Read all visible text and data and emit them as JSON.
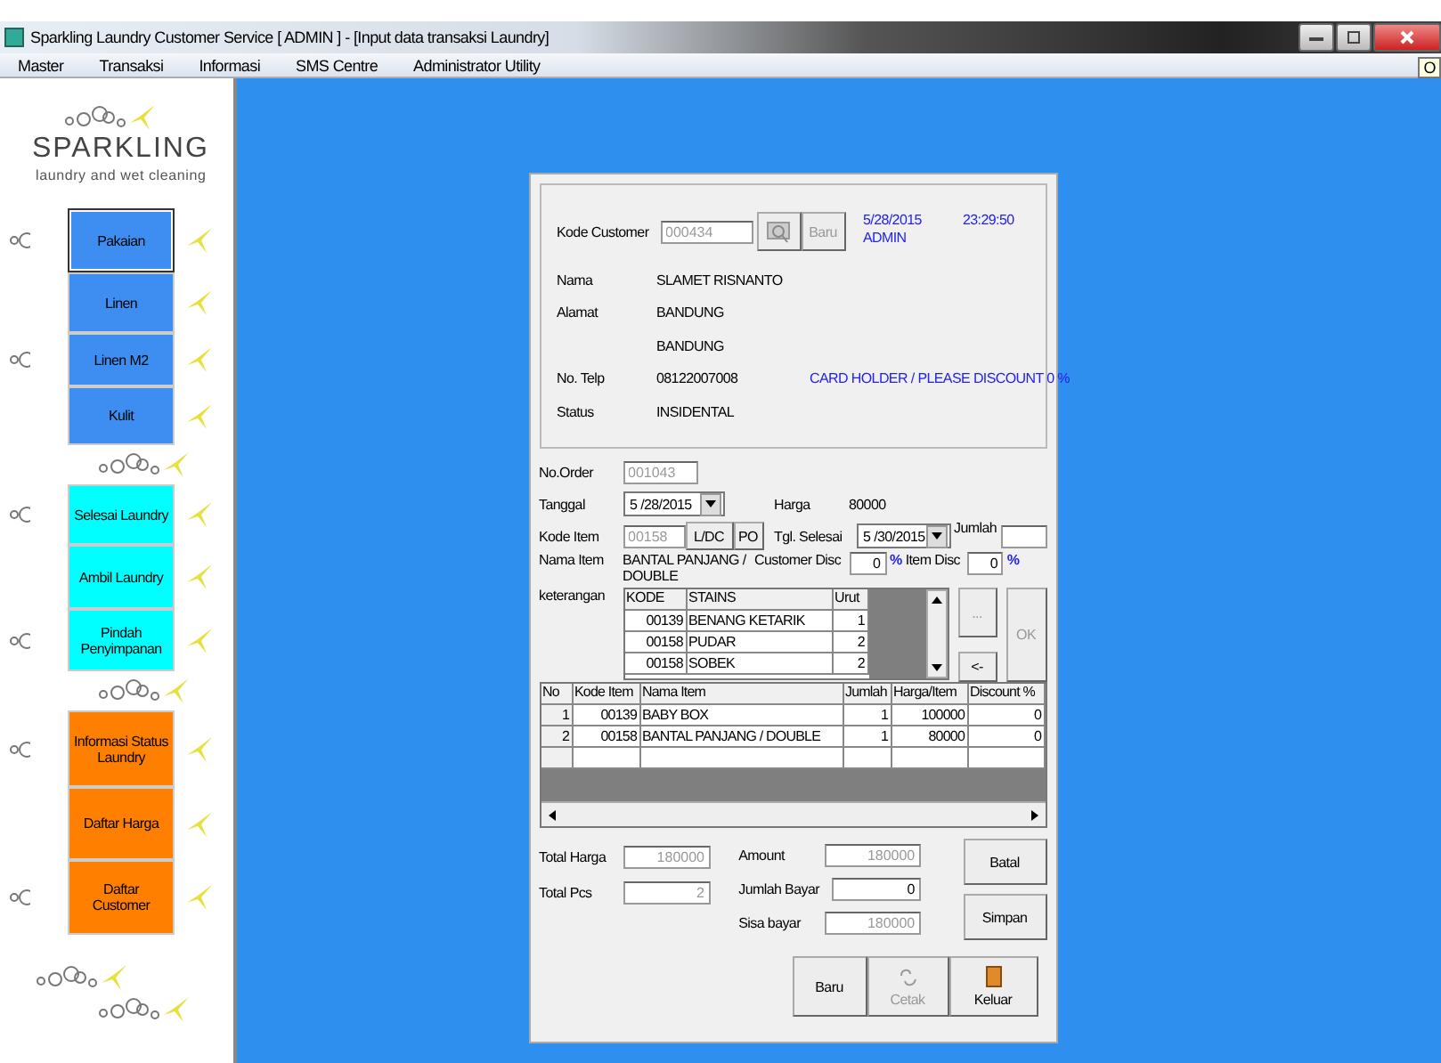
{
  "window": {
    "title": "Sparkling Laundry Customer Service [ ADMIN ] - [Input data transaksi Laundry]",
    "tooltip": "O"
  },
  "menu": [
    "Master",
    "Transaksi",
    "Informasi",
    "SMS Centre",
    "Administrator Utility"
  ],
  "brand": {
    "name": "SPARKLING",
    "tagline": "laundry and wet cleaning"
  },
  "sidebar": {
    "groups": [
      {
        "color": "#3d8ef0",
        "items": [
          {
            "label": "Pakaian",
            "selected": true
          },
          {
            "label": "Linen",
            "selected": false
          },
          {
            "label": "Linen M2",
            "selected": false
          },
          {
            "label": "Kulit",
            "selected": false
          }
        ]
      },
      {
        "color": "#00ffff",
        "items": [
          {
            "label": "Selesai Laundry",
            "selected": false
          },
          {
            "label": "Ambil Laundry",
            "selected": false
          },
          {
            "label": "Pindah Penyimpanan",
            "selected": false
          }
        ]
      },
      {
        "color": "#ff7f00",
        "items": [
          {
            "label": "Informasi Status Laundry",
            "selected": false
          },
          {
            "label": "Daftar Harga",
            "selected": false
          },
          {
            "label": "Daftar Customer",
            "selected": false
          }
        ]
      }
    ]
  },
  "customer": {
    "code_label": "Kode Customer",
    "code": "000434",
    "new_button": {
      "label": "Baru",
      "disabled": true
    },
    "date": "5/28/2015",
    "time": "23:29:50",
    "user": "ADMIN",
    "fields": [
      {
        "label": "Nama",
        "value": "SLAMET RISNANTO"
      },
      {
        "label": "Alamat",
        "value": "BANDUNG"
      },
      {
        "value": "BANDUNG"
      },
      {
        "label": "No. Telp",
        "value": "08122007008"
      },
      {
        "label": "Status",
        "value": "INSIDENTAL"
      }
    ],
    "notice": "CARD HOLDER / PLEASE DISCOUNT 0 %"
  },
  "order": {
    "no_label": "No.Order",
    "no": "001043",
    "date_label": "Tanggal",
    "date": "5 /28/2015",
    "price_label": "Harga",
    "price": "80000",
    "item_label": "Kode Item",
    "item_code": "00158",
    "ldc_button": "L/DC",
    "po_button": "PO",
    "finish_label": "Tgl. Selesai",
    "finish_date": "5 /30/2015",
    "qty_label": "Jumlah",
    "name_label": "Nama Item",
    "item_name": "BANTAL PANJANG / DOUBLE",
    "cust_disc_label": "Customer Disc",
    "cust_disc": "0",
    "item_disc_label": "Item Disc",
    "item_disc": "0",
    "percent": "%",
    "note_label": "keterangan",
    "stains": {
      "columns": [
        "KODE",
        "STAINS",
        "Urut"
      ],
      "rows": [
        [
          "00139",
          "BENANG KETARIK",
          "1"
        ],
        [
          "00158",
          "PUDAR",
          "2"
        ],
        [
          "00158",
          "SOBEK",
          "2"
        ]
      ]
    },
    "side_buttons": [
      {
        "label": "...",
        "disabled": true
      },
      {
        "label": "<-",
        "disabled": false
      },
      {
        "label": "OK",
        "disabled": true
      }
    ]
  },
  "items": {
    "columns": [
      "No",
      "Kode Item",
      "Nama Item",
      "Jumlah",
      "Harga/Item",
      "Discount %"
    ],
    "rows": [
      [
        "1",
        "00139",
        "BABY BOX",
        "1",
        "100000",
        "0"
      ],
      [
        "2",
        "00158",
        "BANTAL PANJANG / DOUBLE",
        "1",
        "80000",
        "0"
      ]
    ]
  },
  "totals": {
    "total_price_label": "Total Harga",
    "total_price": "180000",
    "total_pcs_label": "Total Pcs",
    "total_pcs": "2",
    "amount_label": "Amount",
    "amount": "180000",
    "paid_label": "Jumlah Bayar",
    "paid": "0",
    "rest_label": "Sisa bayar",
    "rest": "180000"
  },
  "buttons": [
    {
      "label": "Batal",
      "kind": "text",
      "disabled": false
    },
    {
      "label": "Simpan",
      "kind": "text",
      "disabled": false
    },
    {
      "label": "Baru",
      "kind": "text",
      "disabled": false
    },
    {
      "label": "Cetak",
      "kind": "print",
      "disabled": true
    },
    {
      "label": "Keluar",
      "kind": "exit",
      "disabled": false
    }
  ]
}
